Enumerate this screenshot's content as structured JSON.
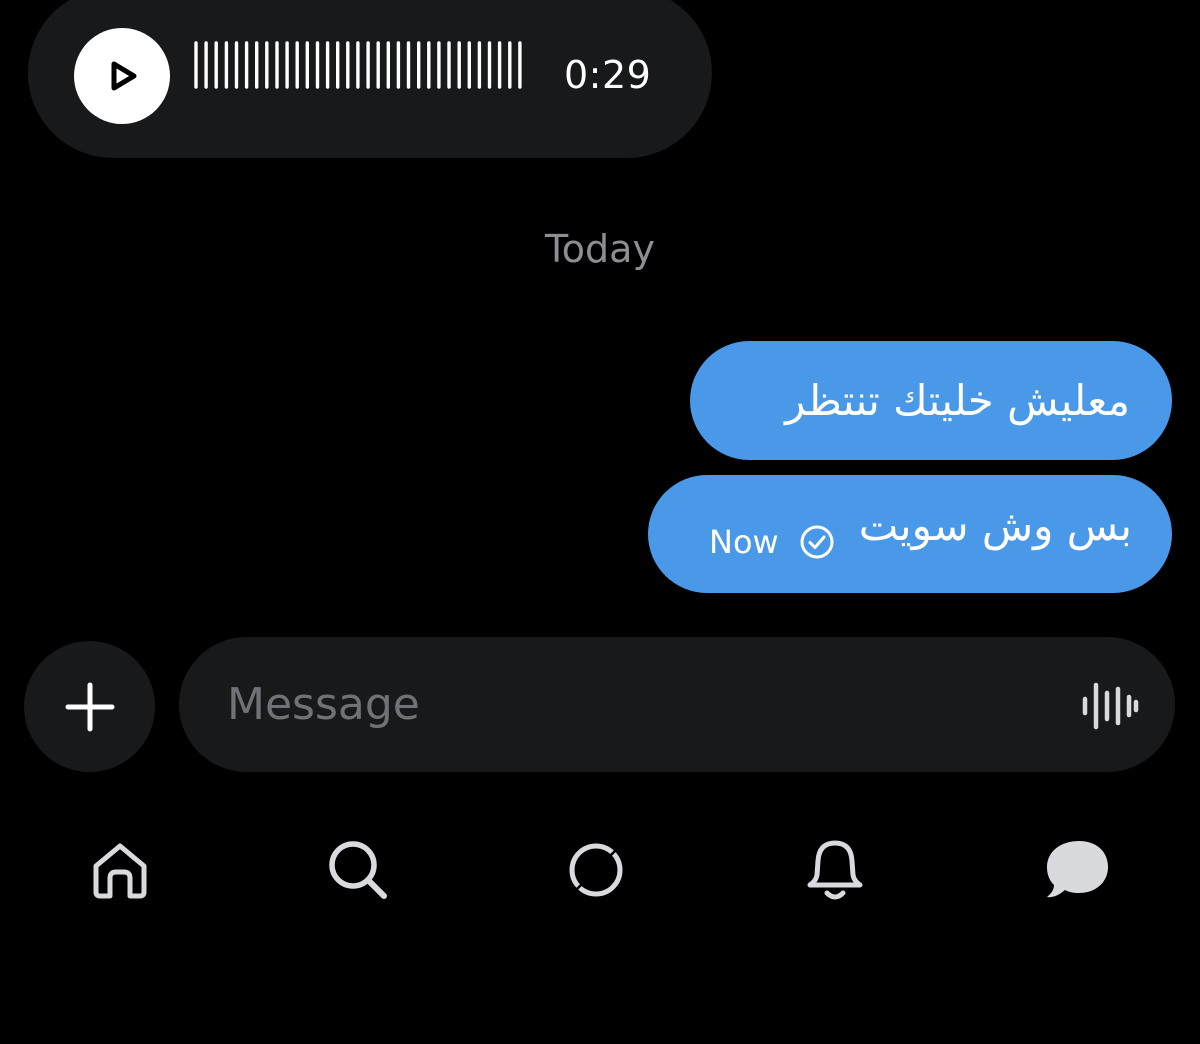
{
  "voice_message": {
    "duration": "0:29",
    "play_icon": "play-icon"
  },
  "conversation": {
    "date_separator": "Today",
    "messages": [
      {
        "text": "معليش خليتك تنتظر"
      },
      {
        "text": "بس وش سويت",
        "time": "Now",
        "status_icon": "read-check-icon"
      }
    ]
  },
  "composer": {
    "add_icon": "plus-icon",
    "placeholder": "Message",
    "value": "",
    "voice_icon": "waveform-icon"
  },
  "tab_bar": {
    "items": [
      {
        "icon": "home-icon"
      },
      {
        "icon": "search-icon"
      },
      {
        "icon": "explore-icon"
      },
      {
        "icon": "bell-icon"
      },
      {
        "icon": "chat-bubble-icon",
        "active": true
      }
    ]
  },
  "colors": {
    "background": "#000000",
    "bubble_dark": "#18191b",
    "bubble_outgoing": "#4a99e9",
    "muted_text": "#8b8e93",
    "placeholder_text": "#6f7378",
    "icon": "#d8dadd"
  }
}
